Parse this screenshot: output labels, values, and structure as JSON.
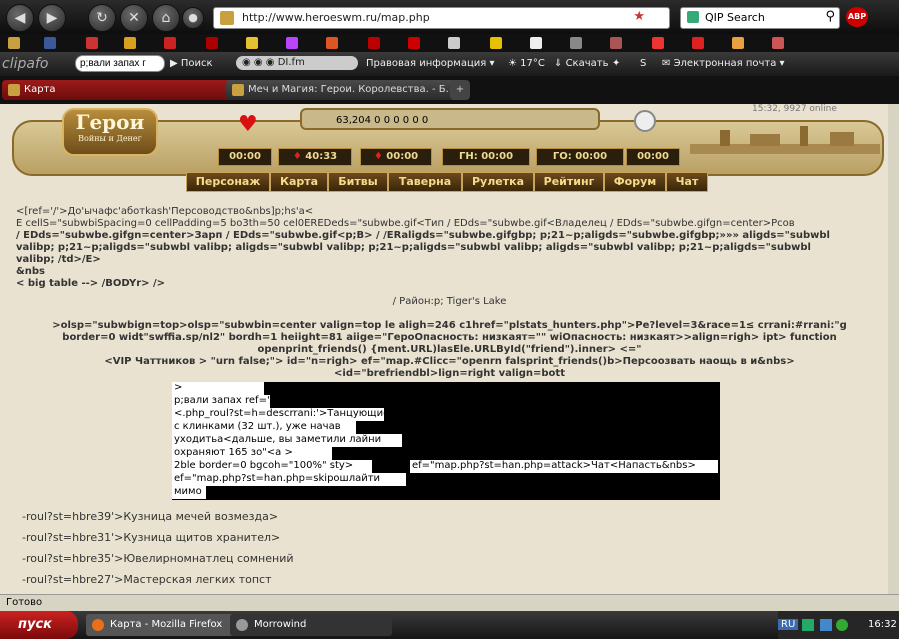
{
  "browser": {
    "url": "http://www.heroeswm.ru/map.php",
    "search_engine": "QIP Search",
    "abp": "ABP"
  },
  "clipafon": {
    "logo": "clipafo",
    "search_value": "р;вали запах г",
    "search_btn": "Поиск",
    "player_text": "DI.fm",
    "legal": "Правовая информация",
    "weather": "17°C",
    "download": "Скачать",
    "email": "Электронная почта"
  },
  "tabs": [
    {
      "label": "Карта"
    },
    {
      "label": "Меч и Магия: Герои. Королевства. - Б..."
    }
  ],
  "game": {
    "logo_title": "Герои",
    "logo_sub": "Войны и Денег",
    "resources": "63,204 0 0 0 0 0 0",
    "online": "15:32, 9927 online",
    "timers": [
      "00:00",
      "40:33",
      "00:00",
      "ГН: 00:00",
      "ГО: 00:00",
      "00:00"
    ],
    "nav": [
      "Персонаж",
      "Карта",
      "Битвы",
      "Таверна",
      "Рулетка",
      "Рейтинг",
      "Форум",
      "Чат"
    ]
  },
  "content": {
    "lines": [
      "<[ref='/'>До'ычафс'аботkash'Персоводство&nbs]p;hs'a<",
      "E cellS=\"subwbiSpacing=0 cellPadding=5 bo3th=50 cel0EREDeds=\"subwbe.gif<Тип / EDds=\"subwbe.gif<Владелец / EDds=\"subwbe.gifgn=center>Рсов",
      "/ EDds=\"subwbe.gifgn=center>Зарп / EDds=\"subwbe.gif<p;B> / /ERaligds=\"subwbe.gifgbp; p;21~p;aligds=\"subwbe.gifgbp;»»» aligds=\"subwbl",
      "valibp; p;21~p;aligds=\"subwbl valibp; aligds=\"subwbl valibp; p;21~p;aligds=\"subwbl valibp; aligds=\"subwbl valibp; p;21~p;aligds=\"subwbl",
      "valibp; /td>/E>",
      "&nbs",
      "< big table --> /BODYr> />"
    ],
    "location": "/ Район:p; Tiger's Lake",
    "code_lines": [
      ">olsp=\"subwbign=top>olsp=\"subwbin=center valign=top le aligh=246 c1href=\"plstats_hunters.php\">Pe?level=3&race=1≤ crrani:#rrani:\"g",
      "border=0 widt\"swffia.sp/nl2\" bordh=1 heiight=81 aiige=\"ГероОпасность: низкаят=\"\" wiОпасность: низкаят>>align=righ> ipt> function",
      "openprint_friends() {ment.URL)lasEle.URLById(\"friend\").inner> <=\"",
      "<VIP Чаттников > \"urn false;\"> id=\"n=righ> ef=\"map.#Clicc=\"openrn falsprint_friends()b>Персоозвать наощь в и&nbs>",
      "<id=\"brefriendbl>lign=right valign=bott"
    ],
    "black_lines": [
      ">",
      "p;вали запах ref='/'>",
      "<.php_roul?st=h=descrrani:'>Танцующие",
      "с клинками (32 шт.), уже начав",
      "уходитьа<дальше, вы заметили лайни",
      "охраняют 165 зо\"<a >",
      "2ble border=0 bgcoh=\"100%\" sty>",
      "ef=\"map.php?st=han.php=attack>Чат<Напасть&nbs>",
      "ef=\"map.php?st=han.php=skipошлайти",
      "мимо"
    ],
    "links": [
      "-roul?st=hbre39'>Кузница мечей возмезда>",
      "-roul?st=hbre31'>Кузница щитов хранител>",
      "-roul?st=hbre35'>Ювелирномнатлец сомнений",
      "-roul?st=hbre27'>Мастерская легких топст"
    ]
  },
  "status": "Готово",
  "taskbar": {
    "start": "пуск",
    "items": [
      "Карта - Mozilla Firefox",
      "Morrowind"
    ],
    "lang": "RU",
    "time": "16:32"
  }
}
